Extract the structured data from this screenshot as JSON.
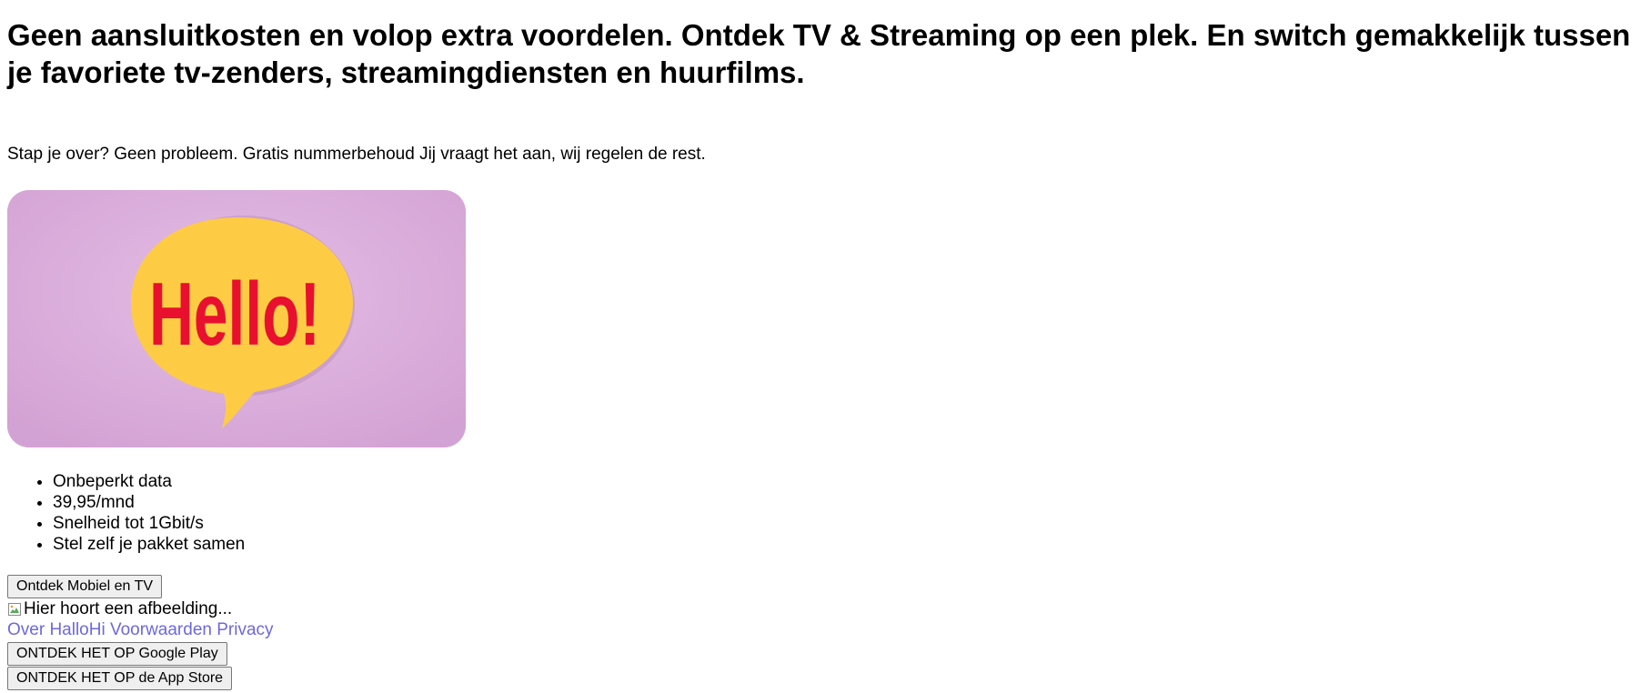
{
  "headline": "Geen aansluitkosten en volop extra voordelen. Ontdek TV & Streaming op een plek. En switch gemakkelijk tussen je favoriete tv-zenders, streamingdiensten en huurfilms.",
  "intro": "Stap je over? Geen probleem. Gratis nummerbehoud Jij vraagt het aan, wij regelen de rest.",
  "hero": {
    "bubble_text": "Hello!",
    "colors": {
      "background": "#ddb0de",
      "bubble": "#fdcc44",
      "text": "#e8102e"
    }
  },
  "features": [
    "Onbeperkt data",
    "39,95/mnd",
    "Snelheid tot 1Gbit/s",
    "Stel zelf je pakket samen"
  ],
  "cta_label": "Ontdek Mobiel en TV",
  "broken_image_alt": "Hier hoort een afbeelding...",
  "footer_links": [
    "Over HalloHi",
    "Voorwaarden",
    "Privacy"
  ],
  "store_buttons": {
    "google_play": "ONTDEK HET OP Google Play",
    "app_store": "ONTDEK HET OP de App Store"
  },
  "link_color": "#6c68e0"
}
